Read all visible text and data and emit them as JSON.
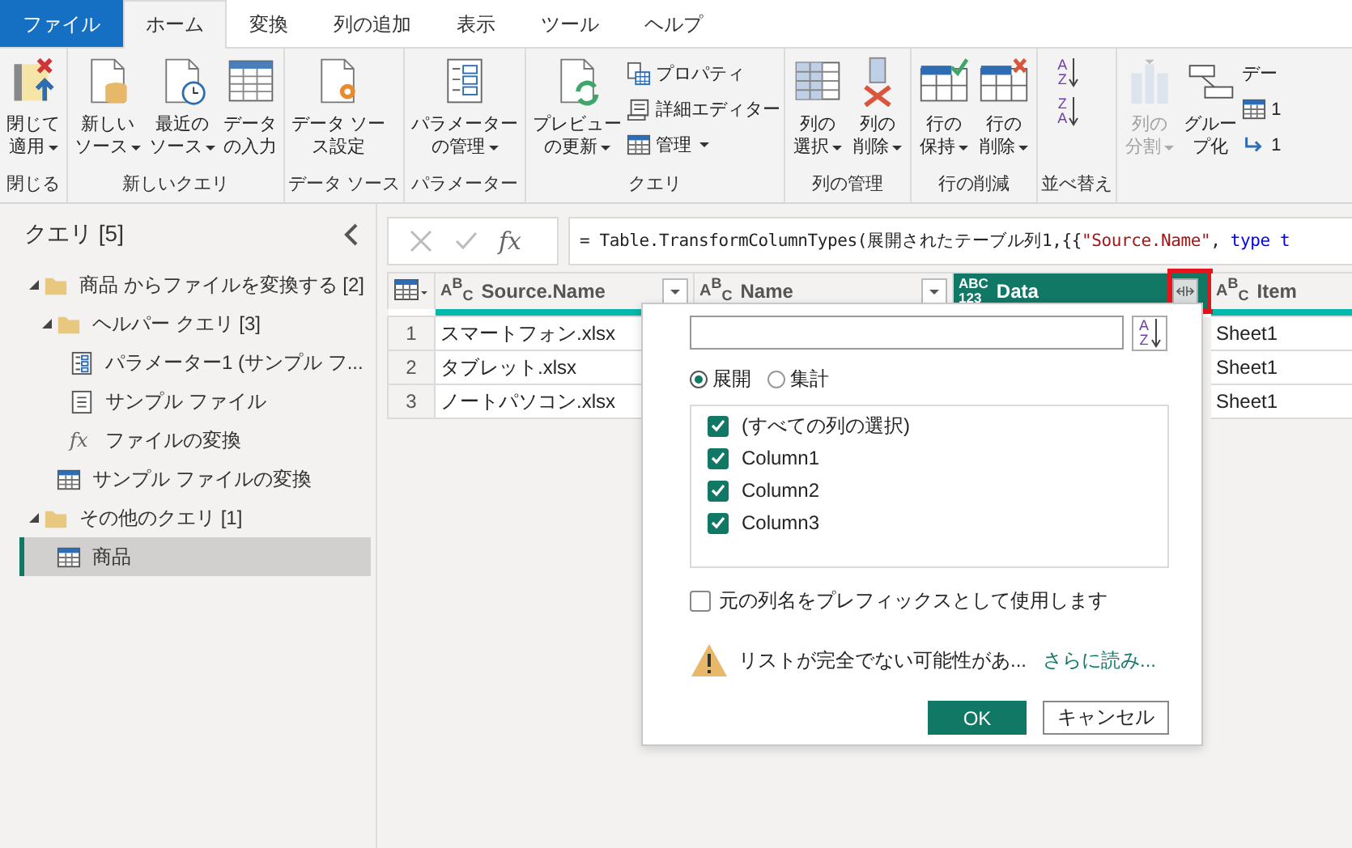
{
  "tabs": [
    {
      "label": "ファイル",
      "kind": "file",
      "selected": false
    },
    {
      "label": "ホーム",
      "kind": "tab",
      "selected": true
    },
    {
      "label": "変換",
      "kind": "tab",
      "selected": false
    },
    {
      "label": "列の追加",
      "kind": "tab",
      "selected": false
    },
    {
      "label": "表示",
      "kind": "tab",
      "selected": false
    },
    {
      "label": "ツール",
      "kind": "tab",
      "selected": false
    },
    {
      "label": "ヘルプ",
      "kind": "tab",
      "selected": false
    }
  ],
  "ribbon": {
    "groups": [
      {
        "label": "閉じる",
        "items": [
          {
            "kind": "large",
            "lines": [
              "閉じて",
              "適用"
            ],
            "dropdown": true,
            "disabled": false
          }
        ]
      },
      {
        "label": "新しいクエリ",
        "items": [
          {
            "kind": "large",
            "lines": [
              "新しい",
              "ソース"
            ],
            "dropdown": true,
            "disabled": false
          },
          {
            "kind": "large",
            "lines": [
              "最近の",
              "ソース"
            ],
            "dropdown": true,
            "disabled": false
          },
          {
            "kind": "large",
            "lines": [
              "データ",
              "の入力"
            ],
            "dropdown": false,
            "disabled": false
          }
        ]
      },
      {
        "label": "データ ソース",
        "items": [
          {
            "kind": "large",
            "lines": [
              "データ ソー",
              "ス設定"
            ],
            "dropdown": false,
            "disabled": false
          }
        ]
      },
      {
        "label": "パラメーター",
        "items": [
          {
            "kind": "large",
            "lines": [
              "パラメーター",
              "の管理"
            ],
            "dropdown": true,
            "disabled": false
          }
        ]
      },
      {
        "label": "クエリ",
        "items": [
          {
            "kind": "large",
            "lines": [
              "プレビュー",
              "の更新"
            ],
            "dropdown": true,
            "disabled": false
          },
          {
            "kind": "small",
            "label": "プロパティ",
            "dropdown": false,
            "disabled": false
          },
          {
            "kind": "small",
            "label": "詳細エディター",
            "dropdown": false,
            "disabled": false
          },
          {
            "kind": "small",
            "label": "管理",
            "dropdown": true,
            "disabled": false
          }
        ]
      },
      {
        "label": "列の管理",
        "items": [
          {
            "kind": "large",
            "lines": [
              "列の",
              "選択"
            ],
            "dropdown": true,
            "disabled": false
          },
          {
            "kind": "large",
            "lines": [
              "列の",
              "削除"
            ],
            "dropdown": true,
            "disabled": false
          }
        ]
      },
      {
        "label": "行の削減",
        "items": [
          {
            "kind": "large",
            "lines": [
              "行の",
              "保持"
            ],
            "dropdown": true,
            "disabled": false
          },
          {
            "kind": "large",
            "lines": [
              "行の",
              "削除"
            ],
            "dropdown": true,
            "disabled": false
          }
        ]
      },
      {
        "label": "並べ替え",
        "items": [
          {
            "kind": "sort",
            "letters": [
              "A",
              "Z"
            ],
            "disabled": false
          },
          {
            "kind": "sort",
            "letters": [
              "Z",
              "A"
            ],
            "disabled": false
          }
        ]
      },
      {
        "items": [
          {
            "kind": "large",
            "lines": [
              "列の",
              "分割"
            ],
            "dropdown": true,
            "disabled": true
          },
          {
            "kind": "large",
            "lines": [
              "グルー",
              "プ化"
            ],
            "dropdown": false,
            "disabled": false
          },
          {
            "kind": "small",
            "label": "デー",
            "dropdown": false,
            "disabled": false
          },
          {
            "kind": "small",
            "label": "1",
            "dropdown": false,
            "disabled": false
          },
          {
            "kind": "small",
            "label": "1",
            "dropdown": false,
            "disabled": false
          }
        ]
      }
    ]
  },
  "queries": {
    "title": "クエリ [5]",
    "tree": [
      {
        "kind": "folder",
        "label": "商品 からファイルを変換する [2]",
        "expanded": true,
        "selected": false,
        "children": [
          {
            "kind": "folder",
            "label": "ヘルパー クエリ [3]",
            "expanded": true,
            "selected": false,
            "children": [
              {
                "kind": "parameter",
                "label": "パラメーター1 (サンプル フ...",
                "selected": false
              },
              {
                "kind": "file",
                "label": "サンプル ファイル",
                "selected": false
              },
              {
                "kind": "function",
                "glyph": "fx",
                "label": "ファイルの変換",
                "selected": false
              }
            ]
          },
          {
            "kind": "table",
            "label": "サンプル ファイルの変換",
            "selected": false
          }
        ]
      },
      {
        "kind": "folder",
        "label": "その他のクエリ [1]",
        "expanded": true,
        "selected": false,
        "children": [
          {
            "kind": "table",
            "label": "商品",
            "selected": true
          }
        ]
      }
    ]
  },
  "formula_bar": {
    "fx": "fx",
    "formula": [
      {
        "kind": "code",
        "text": "= Table.TransformColumnTypes(展開されたテーブル列1,{{"
      },
      {
        "kind": "string",
        "text": "\"Source.Name\""
      },
      {
        "kind": "code",
        "text": ", "
      },
      {
        "kind": "keyword",
        "text": "type t"
      }
    ]
  },
  "table": {
    "columns": [
      {
        "name": "Source.Name",
        "type_label": [
          "A$^{B}$$_{C}$"
        ],
        "selected": false,
        "kind": "filter",
        "highlighted": false
      },
      {
        "name": "Name",
        "type_label": [
          "A$^{B}$$_{C}$"
        ],
        "selected": false,
        "kind": "filter",
        "highlighted": false
      },
      {
        "name": "Data",
        "type_label": [
          "ABC",
          "123"
        ],
        "selected": true,
        "kind": "expand",
        "highlighted": true
      },
      {
        "name": "Item",
        "type_label": [
          "A$^{B}$$_{C}$"
        ],
        "selected": false,
        "kind": "plain",
        "highlighted": false
      }
    ],
    "rows": [
      {
        "number": "1",
        "cells": [
          "スマートフォン.xlsx",
          "",
          "",
          "Sheet1"
        ]
      },
      {
        "number": "2",
        "cells": [
          "タブレット.xlsx",
          "",
          "",
          "Sheet1"
        ]
      },
      {
        "number": "3",
        "cells": [
          "ノートパソコン.xlsx",
          "",
          "",
          "Sheet1"
        ]
      }
    ]
  },
  "expand_popup": {
    "sort_letters": [
      "A",
      "Z"
    ],
    "options": [
      {
        "label": "展開",
        "selected": true
      },
      {
        "label": "集計",
        "selected": false
      }
    ],
    "columns": [
      {
        "label": "(すべての列の選択)",
        "checked": true
      },
      {
        "label": "Column1",
        "checked": true
      },
      {
        "label": "Column2",
        "checked": true
      },
      {
        "label": "Column3",
        "checked": true
      }
    ],
    "prefix": {
      "label": "元の列名をプレフィックスとして使用します",
      "checked": false
    },
    "warning": "リストが完全でない可能性があ...",
    "more_link": "さらに読み...",
    "buttons": [
      {
        "label": "OK",
        "kind": "primary"
      },
      {
        "label": "キャンセル",
        "kind": "secondary"
      }
    ]
  }
}
